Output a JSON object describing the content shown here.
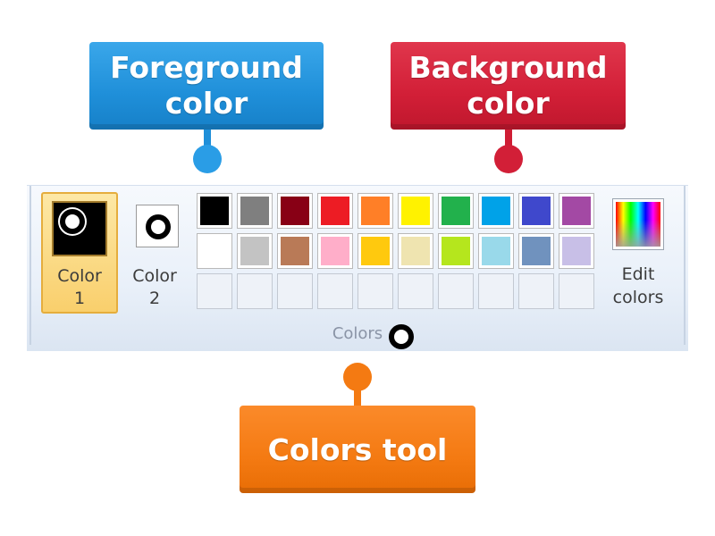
{
  "callouts": {
    "foreground": {
      "label": "Foreground\ncolor",
      "color": "#1f8fd9"
    },
    "background": {
      "label": "Background\ncolor",
      "color": "#d21f37"
    },
    "colors_tool": {
      "label": "Colors tool",
      "color": "#f47a12"
    }
  },
  "ribbon": {
    "color1": {
      "label": "Color\n1",
      "value": "#000000",
      "selected": true
    },
    "color2": {
      "label": "Color\n2",
      "value": "#ffffff",
      "selected": false
    },
    "palette_rows": [
      [
        "#000000",
        "#7f7f7f",
        "#880015",
        "#ed1c24",
        "#ff7f27",
        "#fff200",
        "#22b14c",
        "#00a2e8",
        "#3f48cc",
        "#a349a4"
      ],
      [
        "#ffffff",
        "#c3c3c3",
        "#b97a57",
        "#ffaec9",
        "#ffc90e",
        "#efe4b0",
        "#b5e61d",
        "#99d9ea",
        "#7092be",
        "#c8bfe7"
      ],
      [
        "",
        "",
        "",
        "",
        "",
        "",
        "",
        "",
        "",
        ""
      ]
    ],
    "edit_colors": {
      "label": "Edit\ncolors",
      "icon": "color-spectrum-icon"
    },
    "group_label": "Colors"
  }
}
